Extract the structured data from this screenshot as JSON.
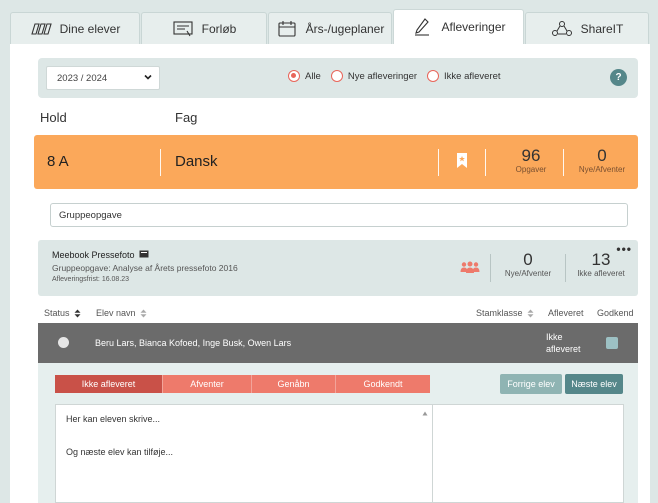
{
  "tabs": [
    {
      "label": "Dine elever",
      "icon": "students-icon"
    },
    {
      "label": "Forløb",
      "icon": "course-icon"
    },
    {
      "label": "Års-/ugeplaner",
      "icon": "calendar-icon"
    },
    {
      "label": "Afleveringer",
      "icon": "pen-icon",
      "active": true
    },
    {
      "label": "ShareIT",
      "icon": "share-icon"
    }
  ],
  "filter": {
    "year": "2023 / 2024",
    "radios": [
      "Alle",
      "Nye afleveringer",
      "Ikke afleveret"
    ],
    "selected": "Alle",
    "help": "?"
  },
  "headers": {
    "hold": "Hold",
    "fag": "Fag"
  },
  "classbar": {
    "class_name": "8 A",
    "subject": "Dansk",
    "opgaver_count": "96",
    "opgaver_label": "Opgaver",
    "nye_count": "0",
    "nye_label": "Nye/Afventer",
    "color": "#fba85a"
  },
  "search": {
    "value": "Gruppeopgave"
  },
  "assignment": {
    "title": "Meebook Pressefoto",
    "subtitle": "Gruppeopgave: Analyse af Årets pressefoto 2016",
    "deadline_label": "Afleveringsfrist:",
    "deadline": "16.08.23",
    "nye_count": "0",
    "nye_label": "Nye/Afventer",
    "ikke_count": "13",
    "ikke_label": "Ikke afleveret",
    "more": "•••"
  },
  "columns": {
    "status": "Status",
    "elevnavn": "Elev navn",
    "stamklasse": "Stamklasse",
    "afleveret": "Afleveret",
    "godkend": "Godkend"
  },
  "student_row": {
    "names": "Beru Lars, Bianca Kofoed, Inge Busk, Owen Lars",
    "status_line1": "Ikke",
    "status_line2": "afleveret"
  },
  "detail": {
    "segments": [
      "Ikke afleveret",
      "Afventer",
      "Genåbn",
      "Godkendt"
    ],
    "active_segment": "Ikke afleveret",
    "prev_label": "Forrige elev",
    "next_label": "Næste elev",
    "text_line1": "Her kan eleven skrive...",
    "text_line2": "Og næste elev kan tilføje..."
  },
  "colors": {
    "accent": "#e8655a",
    "teal": "#55878a",
    "segment_active": "#c95148",
    "segment": "#ee7a6b"
  }
}
